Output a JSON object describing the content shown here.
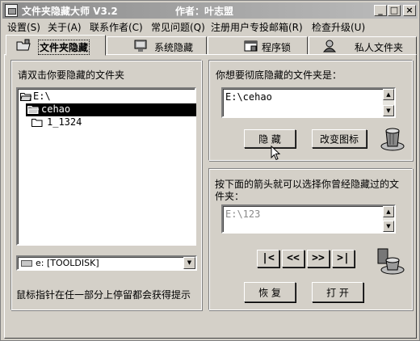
{
  "window": {
    "title": "文件夹隐藏大师 V3.2",
    "author": "作者：叶志盟",
    "buttons": {
      "minimize": "_",
      "maximize": "□",
      "close": "×"
    }
  },
  "menu": [
    {
      "label": "设置(S)"
    },
    {
      "label": "关于(A)"
    },
    {
      "label": "联系作者(C)"
    },
    {
      "label": "常见问题(Q)"
    },
    {
      "label": "注册用户专投邮箱(R)"
    },
    {
      "label": "检查升级(U)"
    }
  ],
  "tabs": [
    {
      "label": "文件夹隐藏",
      "active": true
    },
    {
      "label": "系统隐藏"
    },
    {
      "label": "程序锁"
    },
    {
      "label": "私人文件夹"
    }
  ],
  "left_panel": {
    "instruction": "请双击你要隐藏的文件夹",
    "tree": [
      {
        "label": "E:\\",
        "level": 0
      },
      {
        "label": "cehao",
        "level": 1,
        "selected": true
      },
      {
        "label": "1_1324",
        "level": 1
      }
    ],
    "drive": {
      "value": "e: [TOOLDISK]"
    },
    "hint": "鼠标指针在任一部分上停留都会获得提示"
  },
  "hide_section": {
    "label": "你想要彻底隐藏的文件夹是：",
    "path": "E:\\cehao",
    "hide_button": "隐 藏",
    "change_icon_button": "改变图标"
  },
  "restore_section": {
    "label_line1": "按下面的箭头就可以选择你曾经隐藏过的文",
    "label_line2": "件夹：",
    "path": "E:\\123",
    "nav": {
      "first": "|<",
      "prev": "<<",
      "next": ">>",
      "last": ">|"
    },
    "restore_button": "恢 复",
    "open_button": "打 开"
  },
  "icons": {
    "app": "folder-lock-icon",
    "trash": "trash-can-icon",
    "drive": "drive-icon"
  }
}
